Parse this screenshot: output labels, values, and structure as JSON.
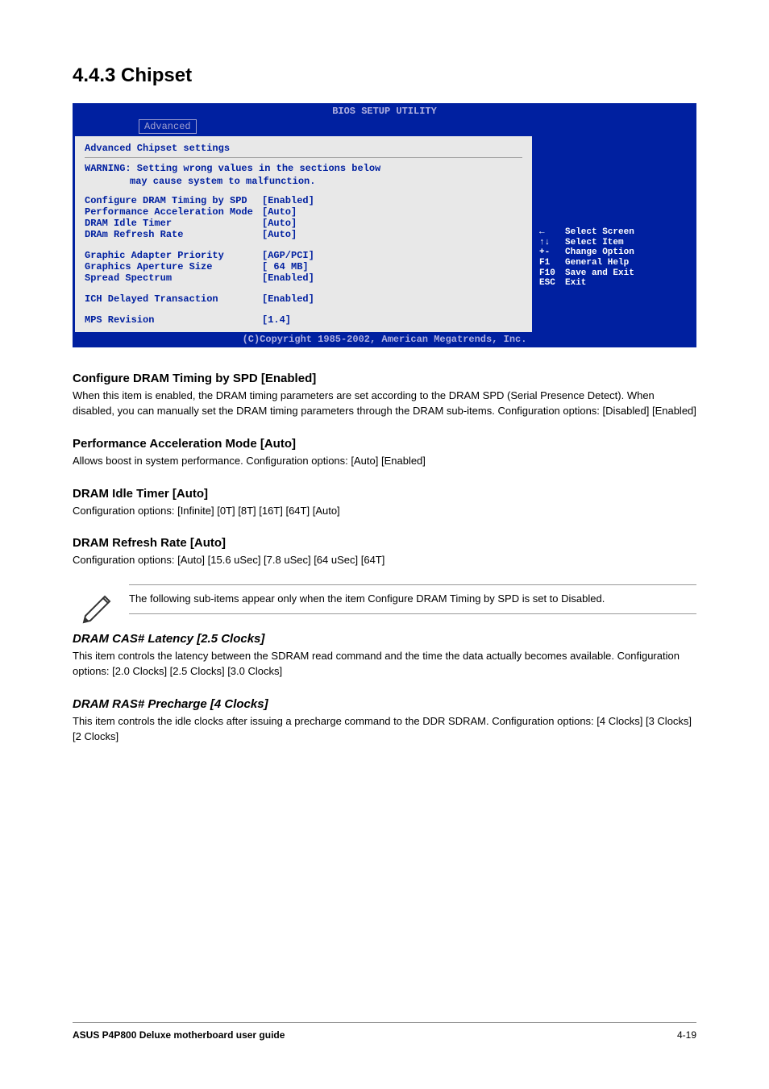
{
  "section_heading": "4.4.3 Chipset",
  "bios": {
    "title": "BIOS SETUP UTILITY",
    "tab": "Advanced",
    "section_title": "Advanced Chipset settings",
    "warning_line1": "WARNING: Setting wrong values in the sections below",
    "warning_line2": "may cause system to malfunction.",
    "rows_group1": [
      {
        "label": "Configure DRAM Timing by SPD",
        "value": "[Enabled]"
      },
      {
        "label": "Performance Acceleration Mode",
        "value": "[Auto]"
      },
      {
        "label": "DRAM Idle Timer",
        "value": "[Auto]"
      },
      {
        "label": "DRAm Refresh Rate",
        "value": "[Auto]"
      }
    ],
    "rows_group2": [
      {
        "label": "Graphic Adapter Priority",
        "value": "[AGP/PCI]"
      },
      {
        "label": "Graphics Aperture Size",
        "value": "[ 64 MB]"
      },
      {
        "label": "Spread Spectrum",
        "value": "[Enabled]"
      }
    ],
    "rows_group3": [
      {
        "label": "ICH Delayed Transaction",
        "value": "[Enabled]"
      }
    ],
    "rows_group4": [
      {
        "label": "MPS Revision",
        "value": "[1.4]"
      }
    ],
    "help": [
      {
        "key": "←",
        "text": "Select Screen"
      },
      {
        "key": "↑↓",
        "text": "Select Item"
      },
      {
        "key": "+-",
        "text": "Change Option"
      },
      {
        "key": "F1",
        "text": "General Help"
      },
      {
        "key": "F10",
        "text": "Save and Exit"
      },
      {
        "key": "ESC",
        "text": "Exit"
      }
    ],
    "footer": "(C)Copyright 1985-2002, American Megatrends, Inc."
  },
  "doc": {
    "sections": [
      {
        "title": "Configure DRAM Timing by SPD [Enabled]",
        "text": "When this item is enabled, the DRAM timing parameters are set according to the DRAM SPD (Serial Presence Detect). When disabled, you can manually set the DRAM timing parameters through the DRAM sub-items. Configuration options: [Disabled] [Enabled]"
      },
      {
        "title": "Performance Acceleration Mode [Auto]",
        "text": "Allows boost in system performance. Configuration options: [Auto] [Enabled]"
      },
      {
        "title": "DRAM Idle Timer [Auto]",
        "text": "Configuration options: [Infinite] [0T] [8T] [16T] [64T] [Auto]"
      },
      {
        "title": "DRAM Refresh Rate [Auto]",
        "text": "Configuration options: [Auto] [15.6 uSec] [7.8 uSec] [64 uSec] [64T]"
      }
    ],
    "note": "The following sub-items appear only when the item Configure DRAM Timing by SPD is set to Disabled.",
    "sections2": [
      {
        "title": "DRAM CAS# Latency [2.5 Clocks]",
        "text": "This item controls the latency between the SDRAM read command and the time the data actually becomes available. Configuration options: [2.0 Clocks] [2.5 Clocks] [3.0 Clocks]"
      },
      {
        "title": "DRAM RAS# Precharge [4 Clocks]",
        "text": "This item controls the idle clocks after issuing a precharge command to the DDR SDRAM. Configuration options: [4 Clocks] [3 Clocks] [2 Clocks]"
      }
    ]
  },
  "footer": {
    "left": "ASUS P4P800 Deluxe motherboard user guide",
    "right": "4-19"
  }
}
